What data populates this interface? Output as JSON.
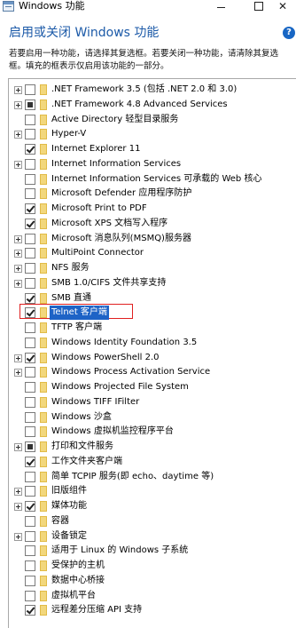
{
  "window": {
    "title": "Windows 功能",
    "min_icon": "minimize-icon",
    "max_icon": "maximize-icon",
    "close_glyph": "✕"
  },
  "heading": "启用或关闭 Windows 功能",
  "help_glyph": "?",
  "description": "若要启用一种功能，请选择其复选框。若要关闭一种功能，请清除其复选框。填充的框表示仅启用该功能的一部分。",
  "features": [
    {
      "label": ".NET Framework 3.5 (包括 .NET 2.0 和 3.0)",
      "expandable": true,
      "state": "unchecked"
    },
    {
      "label": ".NET Framework 4.8 Advanced Services",
      "expandable": true,
      "state": "partial"
    },
    {
      "label": "Active Directory 轻型目录服务",
      "expandable": false,
      "state": "unchecked"
    },
    {
      "label": "Hyper-V",
      "expandable": true,
      "state": "unchecked"
    },
    {
      "label": "Internet Explorer 11",
      "expandable": false,
      "state": "checked"
    },
    {
      "label": "Internet Information Services",
      "expandable": true,
      "state": "unchecked"
    },
    {
      "label": "Internet Information Services 可承载的 Web 核心",
      "expandable": false,
      "state": "unchecked"
    },
    {
      "label": "Microsoft Defender 应用程序防护",
      "expandable": false,
      "state": "unchecked"
    },
    {
      "label": "Microsoft Print to PDF",
      "expandable": false,
      "state": "checked"
    },
    {
      "label": "Microsoft XPS 文档写入程序",
      "expandable": false,
      "state": "checked"
    },
    {
      "label": "Microsoft 消息队列(MSMQ)服务器",
      "expandable": true,
      "state": "unchecked"
    },
    {
      "label": "MultiPoint Connector",
      "expandable": true,
      "state": "unchecked"
    },
    {
      "label": "NFS 服务",
      "expandable": true,
      "state": "unchecked"
    },
    {
      "label": "SMB 1.0/CIFS 文件共享支持",
      "expandable": true,
      "state": "unchecked"
    },
    {
      "label": "SMB 直通",
      "expandable": false,
      "state": "checked"
    },
    {
      "label": "Telnet 客户端",
      "expandable": false,
      "state": "checked",
      "selected": true
    },
    {
      "label": "TFTP 客户端",
      "expandable": false,
      "state": "unchecked"
    },
    {
      "label": "Windows Identity Foundation 3.5",
      "expandable": false,
      "state": "unchecked"
    },
    {
      "label": "Windows PowerShell 2.0",
      "expandable": true,
      "state": "checked"
    },
    {
      "label": "Windows Process Activation Service",
      "expandable": true,
      "state": "unchecked"
    },
    {
      "label": "Windows Projected File System",
      "expandable": false,
      "state": "unchecked"
    },
    {
      "label": "Windows TIFF IFilter",
      "expandable": false,
      "state": "unchecked"
    },
    {
      "label": "Windows 沙盒",
      "expandable": false,
      "state": "unchecked"
    },
    {
      "label": "Windows 虚拟机监控程序平台",
      "expandable": false,
      "state": "unchecked"
    },
    {
      "label": "打印和文件服务",
      "expandable": true,
      "state": "partial"
    },
    {
      "label": "工作文件夹客户端",
      "expandable": false,
      "state": "checked"
    },
    {
      "label": "简单 TCPIP 服务(即 echo、daytime 等)",
      "expandable": false,
      "state": "unchecked"
    },
    {
      "label": "旧版组件",
      "expandable": true,
      "state": "unchecked"
    },
    {
      "label": "媒体功能",
      "expandable": true,
      "state": "checked"
    },
    {
      "label": "容器",
      "expandable": false,
      "state": "unchecked"
    },
    {
      "label": "设备锁定",
      "expandable": true,
      "state": "unchecked"
    },
    {
      "label": "适用于 Linux 的 Windows 子系统",
      "expandable": false,
      "state": "unchecked"
    },
    {
      "label": "受保护的主机",
      "expandable": false,
      "state": "unchecked"
    },
    {
      "label": "数据中心桥接",
      "expandable": false,
      "state": "unchecked"
    },
    {
      "label": "虚拟机平台",
      "expandable": false,
      "state": "unchecked"
    },
    {
      "label": "远程差分压缩 API 支持",
      "expandable": false,
      "state": "checked"
    }
  ],
  "colors": {
    "heading": "#1c5aa8",
    "selection": "#1e63c6",
    "highlight_box": "#e02020",
    "folder": "#f2d77c"
  }
}
